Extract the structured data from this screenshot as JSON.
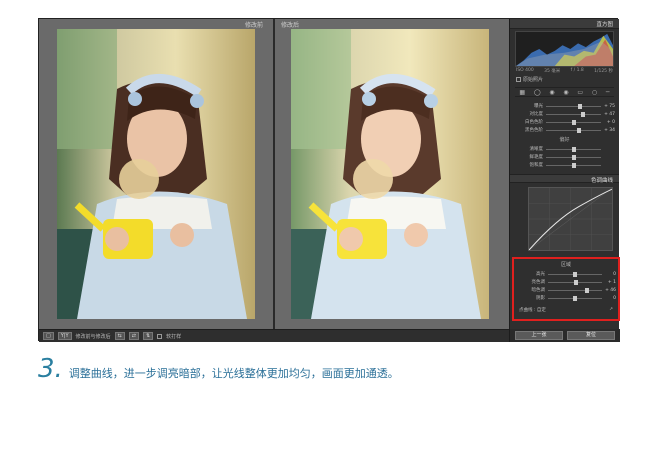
{
  "viewer": {
    "before_label": "修改前",
    "after_label": "修改后"
  },
  "bottom_bar": {
    "view_button": "Y|Y",
    "compare_label": "修改前与修改后",
    "soft_proof_label": "软打样"
  },
  "panel": {
    "histogram_title": "直方图",
    "histogram_info": [
      "ISO 400",
      "35 毫米",
      "f / 1.8",
      "1/125 秒"
    ],
    "original_photo_label": "原始照片",
    "basic_sliders": [
      {
        "label": "曝光",
        "value": "+ 75",
        "level": 0.62
      },
      {
        "label": "对比度",
        "value": "+ 47",
        "level": 0.68
      },
      {
        "label": "白色色阶",
        "value": "+ 0",
        "level": 0.5
      },
      {
        "label": "黑色色阶",
        "value": "+ 34",
        "level": 0.6
      }
    ],
    "presence_title": "偏好",
    "presence_sliders": [
      {
        "label": "清晰度",
        "value": "",
        "level": 0.5
      },
      {
        "label": "鲜艳度",
        "value": "",
        "level": 0.5
      },
      {
        "label": "饱和度",
        "value": "",
        "level": 0.5
      }
    ],
    "tone_curve_title": "色调曲线",
    "region_title": "区域",
    "region_sliders": [
      {
        "label": "高光",
        "value": "0",
        "level": 0.5
      },
      {
        "label": "亮色调",
        "value": "+ 1",
        "level": 0.52
      },
      {
        "label": "暗色调",
        "value": "+ 46",
        "level": 0.73
      },
      {
        "label": "阴影",
        "value": "0",
        "level": 0.5
      }
    ],
    "point_curve_label": "点曲线 :",
    "point_curve_value": "自定",
    "prev_button": "上一张",
    "reset_button": "复位"
  },
  "caption": {
    "step_number": "3.",
    "text": "调整曲线，进一步调亮暗部，让光线整体更加均匀，画面更加通透。"
  },
  "colors": {
    "region_highlight": "#e0201e",
    "caption": "#2a7fa0"
  }
}
